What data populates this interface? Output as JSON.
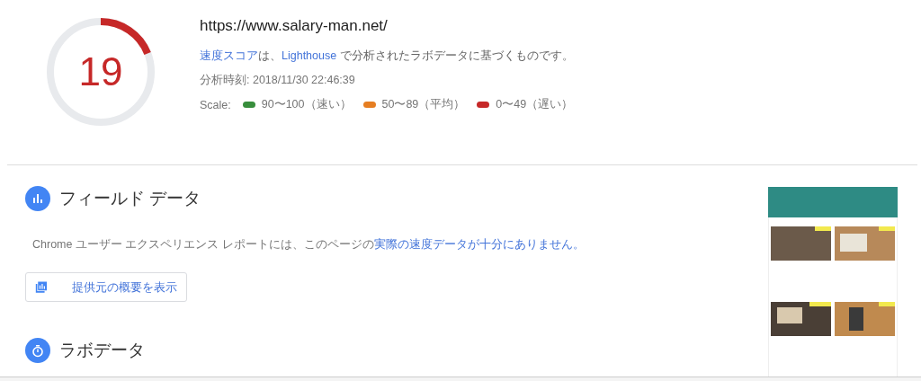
{
  "score": {
    "value": "19"
  },
  "summary": {
    "url": "https://www.salary-man.net/",
    "description_parts": [
      {
        "text": "速度スコア",
        "link": true
      },
      {
        "text": "は、",
        "link": false
      },
      {
        "text": "Lighthouse",
        "link": true
      },
      {
        "text": " で分析されたラボデータに基づくものです。",
        "link": false
      }
    ],
    "analysis_time": "分析時刻: 2018/11/30 22:46:39",
    "scale_label": "Scale:",
    "scale": [
      {
        "label": "90〜100（速い）",
        "color": "#388e3c"
      },
      {
        "label": "50〜89（平均）",
        "color": "#e67e22"
      },
      {
        "label": "0〜49（遅い）",
        "color": "#c62828"
      }
    ]
  },
  "field_data": {
    "title": "フィールド データ",
    "message": "Chrome ユーザー エクスペリエンス レポートには、このページの",
    "message_link": "実際の速度データが十分にありません。",
    "button": "提供元の概要を表示"
  },
  "lab_data": {
    "title": "ラボデータ"
  }
}
